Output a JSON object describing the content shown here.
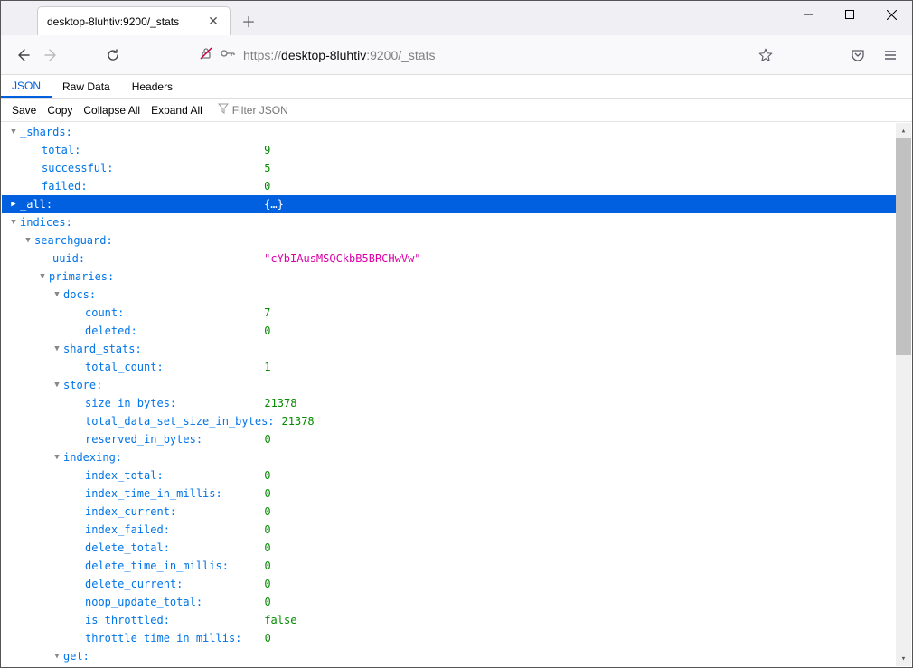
{
  "tab": {
    "title": "desktop-8luhtiv:9200/_stats"
  },
  "url": {
    "prefix": "https://",
    "host": "desktop-8luhtiv",
    "suffix": ":9200/_stats"
  },
  "viewtabs": {
    "json": "JSON",
    "raw": "Raw Data",
    "headers": "Headers"
  },
  "actions": {
    "save": "Save",
    "copy": "Copy",
    "collapse": "Collapse All",
    "expand": "Expand All",
    "filter_placeholder": "Filter JSON"
  },
  "rows": [
    {
      "indent": 8,
      "toggle": "down",
      "key": "_shards:",
      "val": "",
      "vclass": ""
    },
    {
      "indent": 32,
      "toggle": "",
      "key": "total:",
      "val": "9",
      "vclass": "num"
    },
    {
      "indent": 32,
      "toggle": "",
      "key": "successful:",
      "val": "5",
      "vclass": "num"
    },
    {
      "indent": 32,
      "toggle": "",
      "key": "failed:",
      "val": "0",
      "vclass": "num"
    },
    {
      "indent": 8,
      "toggle": "right",
      "key": "_all:",
      "val": "{…}",
      "vclass": "obj",
      "selected": true
    },
    {
      "indent": 8,
      "toggle": "down",
      "key": "indices:",
      "val": "",
      "vclass": ""
    },
    {
      "indent": 24,
      "toggle": "down",
      "key": "searchguard:",
      "val": "",
      "vclass": ""
    },
    {
      "indent": 44,
      "toggle": "",
      "key": "uuid:",
      "val": "\"cYbIAusMSQCkbB5BRCHwVw\"",
      "vclass": "str"
    },
    {
      "indent": 40,
      "toggle": "down",
      "key": "primaries:",
      "val": "",
      "vclass": ""
    },
    {
      "indent": 56,
      "toggle": "down",
      "key": "docs:",
      "val": "",
      "vclass": ""
    },
    {
      "indent": 80,
      "toggle": "",
      "key": "count:",
      "val": "7",
      "vclass": "num"
    },
    {
      "indent": 80,
      "toggle": "",
      "key": "deleted:",
      "val": "0",
      "vclass": "num"
    },
    {
      "indent": 56,
      "toggle": "down",
      "key": "shard_stats:",
      "val": "",
      "vclass": ""
    },
    {
      "indent": 80,
      "toggle": "",
      "key": "total_count:",
      "val": "1",
      "vclass": "num"
    },
    {
      "indent": 56,
      "toggle": "down",
      "key": "store:",
      "val": "",
      "vclass": ""
    },
    {
      "indent": 80,
      "toggle": "",
      "key": "size_in_bytes:",
      "val": "21378",
      "vclass": "num"
    },
    {
      "indent": 80,
      "toggle": "",
      "key": "total_data_set_size_in_bytes:",
      "val": "21378",
      "vclass": "num"
    },
    {
      "indent": 80,
      "toggle": "",
      "key": "reserved_in_bytes:",
      "val": "0",
      "vclass": "num"
    },
    {
      "indent": 56,
      "toggle": "down",
      "key": "indexing:",
      "val": "",
      "vclass": ""
    },
    {
      "indent": 80,
      "toggle": "",
      "key": "index_total:",
      "val": "0",
      "vclass": "num"
    },
    {
      "indent": 80,
      "toggle": "",
      "key": "index_time_in_millis:",
      "val": "0",
      "vclass": "num"
    },
    {
      "indent": 80,
      "toggle": "",
      "key": "index_current:",
      "val": "0",
      "vclass": "num"
    },
    {
      "indent": 80,
      "toggle": "",
      "key": "index_failed:",
      "val": "0",
      "vclass": "num"
    },
    {
      "indent": 80,
      "toggle": "",
      "key": "delete_total:",
      "val": "0",
      "vclass": "num"
    },
    {
      "indent": 80,
      "toggle": "",
      "key": "delete_time_in_millis:",
      "val": "0",
      "vclass": "num"
    },
    {
      "indent": 80,
      "toggle": "",
      "key": "delete_current:",
      "val": "0",
      "vclass": "num"
    },
    {
      "indent": 80,
      "toggle": "",
      "key": "noop_update_total:",
      "val": "0",
      "vclass": "num"
    },
    {
      "indent": 80,
      "toggle": "",
      "key": "is_throttled:",
      "val": "false",
      "vclass": "bool"
    },
    {
      "indent": 80,
      "toggle": "",
      "key": "throttle_time_in_millis:",
      "val": "0",
      "vclass": "num"
    },
    {
      "indent": 56,
      "toggle": "down",
      "key": "get:",
      "val": "",
      "vclass": ""
    }
  ]
}
